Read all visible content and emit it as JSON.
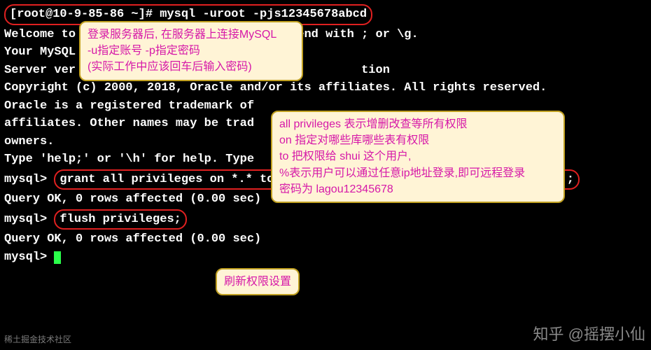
{
  "terminal": {
    "cmd1": "[root@10-9-85-86 ~]# mysql -uroot -pjs12345678abcd",
    "l1": "Welcome to the MariaDB monitor. Commands end with ; or \\g.",
    "l2": "Your MySQL",
    "l3": "Server ver                                        tion",
    "l4": "",
    "l5": "Copyright (c) 2000, 2018, Oracle and/or its affiliates. All rights reserved.",
    "l6": "",
    "l7": "Oracle is a registered trademark of",
    "l8": "affiliates. Other names may be trad",
    "l9": "owners.",
    "l10": "",
    "l11": "Type 'help;' or '\\h' for help. Type                                          .",
    "l12": "",
    "prompt1": "mysql> ",
    "cmd2": "grant all privileges on *.* to 'shui'@'%' identified by 'lagou12345678';",
    "l13": "Query OK, 0 rows affected (0.00 sec)",
    "l14": "",
    "prompt2": "mysql> ",
    "cmd3": "flush privileges;",
    "l15": "Query OK, 0 rows affected (0.00 sec)",
    "l16": "",
    "prompt3": "mysql> "
  },
  "annots": {
    "a1_l1": "登录服务器后, 在服务器上连接MySQL",
    "a1_l2": "-u指定账号  -p指定密码",
    "a1_l3": "(实际工作中应该回车后输入密码)",
    "a2_l1": "all privileges 表示增删改查等所有权限",
    "a2_l2": "on  指定对哪些库哪些表有权限",
    "a2_l3": "to 把权限给 shui 这个用户,",
    "a2_l4": "%表示用户可以通过任意ip地址登录,即可远程登录",
    "a2_l5": "密码为 lagou12345678",
    "a3": "刷新权限设置"
  },
  "watermark": {
    "right": "知乎 @摇摆小仙",
    "left": "稀土掘金技术社区"
  }
}
